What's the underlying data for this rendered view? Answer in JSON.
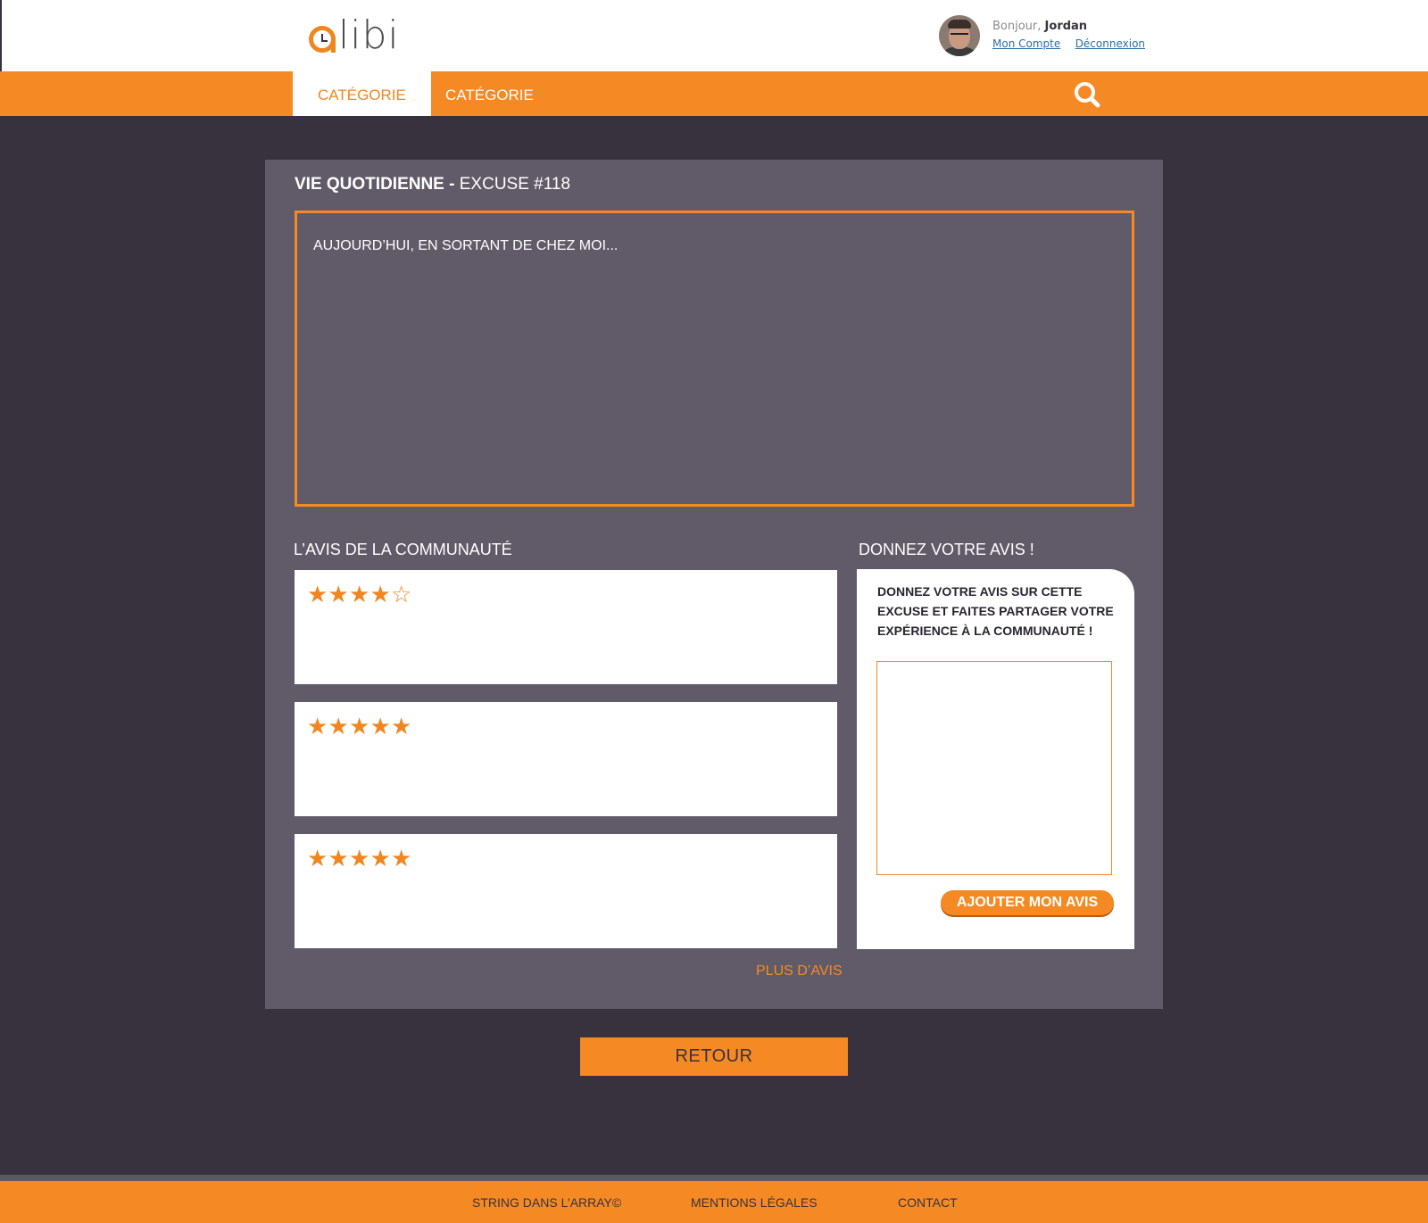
{
  "brand": {
    "logo_text": "libi",
    "accent": "#f58a24",
    "dark": "#38323f"
  },
  "user": {
    "greeting_prefix": "Bonjour,",
    "name": "Jordan",
    "account_link": "Mon Compte",
    "logout_link": "Déconnexion"
  },
  "nav": {
    "tabs": [
      {
        "label": "CATÉGORIE",
        "active": true
      },
      {
        "label": "CATÉGORIE",
        "active": false
      }
    ],
    "search_icon": "search-icon"
  },
  "excuse": {
    "category": "VIE QUOTIDIENNE -",
    "number": "EXCUSE #118",
    "text": "AUJOURD’HUI, EN SORTANT DE CHEZ MOI..."
  },
  "community": {
    "title": "L’AVIS DE LA COMMUNAUTÉ",
    "reviews": [
      {
        "rating": 4,
        "max": 5
      },
      {
        "rating": 5,
        "max": 5
      },
      {
        "rating": 5,
        "max": 5
      }
    ],
    "more_link": "PLUS D’AVIS"
  },
  "give_review": {
    "title": "DONNEZ VOTRE AVIS !",
    "prompt": "DONNEZ VOTRE AVIS SUR CETTE EXCUSE ET FAITES PARTAGER VOTRE EXPÉRIENCE À LA COMMUNAUTÉ !",
    "textarea_value": "",
    "submit_label": "AJOUTER MON AVIS"
  },
  "back_label": "RETOUR",
  "footer": {
    "copyright": "STRING DANS L’ARRAY©",
    "legal": "MENTIONS LÉGALES",
    "contact": "CONTACT"
  }
}
